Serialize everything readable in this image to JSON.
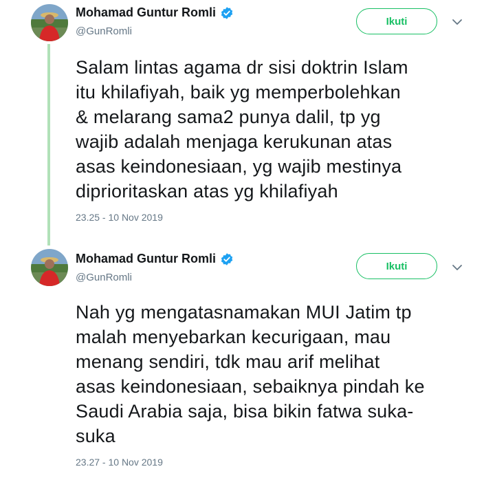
{
  "tweets": [
    {
      "author_name": "Mohamad Guntur Romli",
      "handle": "@GunRomli",
      "follow_label": "Ikuti",
      "text": "Salam lintas agama dr sisi doktrin Islam\nitu khilafiyah, baik yg memperbolehkan\n& melarang sama2 punya dalil, tp yg\nwajib adalah menjaga kerukunan atas\nasas keindonesiaan, yg wajib mestinya\ndiprioritaskan atas yg khilafiyah",
      "timestamp": "23.25 - 10 Nov 2019"
    },
    {
      "author_name": "Mohamad Guntur Romli",
      "handle": "@GunRomli",
      "follow_label": "Ikuti",
      "text": "Nah yg mengatasnamakan MUI Jatim tp\nmalah menyebarkan kecurigaan, mau\nmenang sendiri, tdk mau arif melihat\nasas keindonesiaan, sebaiknya pindah ke\nSaudi Arabia saja, bisa bikin fatwa suka-\nsuka",
      "timestamp": "23.27 - 10 Nov 2019"
    }
  ],
  "colors": {
    "accent": "#17bf63",
    "verified": "#1da1f2",
    "thread_line": "#b1e1b8",
    "secondary_text": "#657786"
  },
  "icons": [
    "avatar",
    "verified-badge-icon",
    "chevron-down-icon"
  ]
}
